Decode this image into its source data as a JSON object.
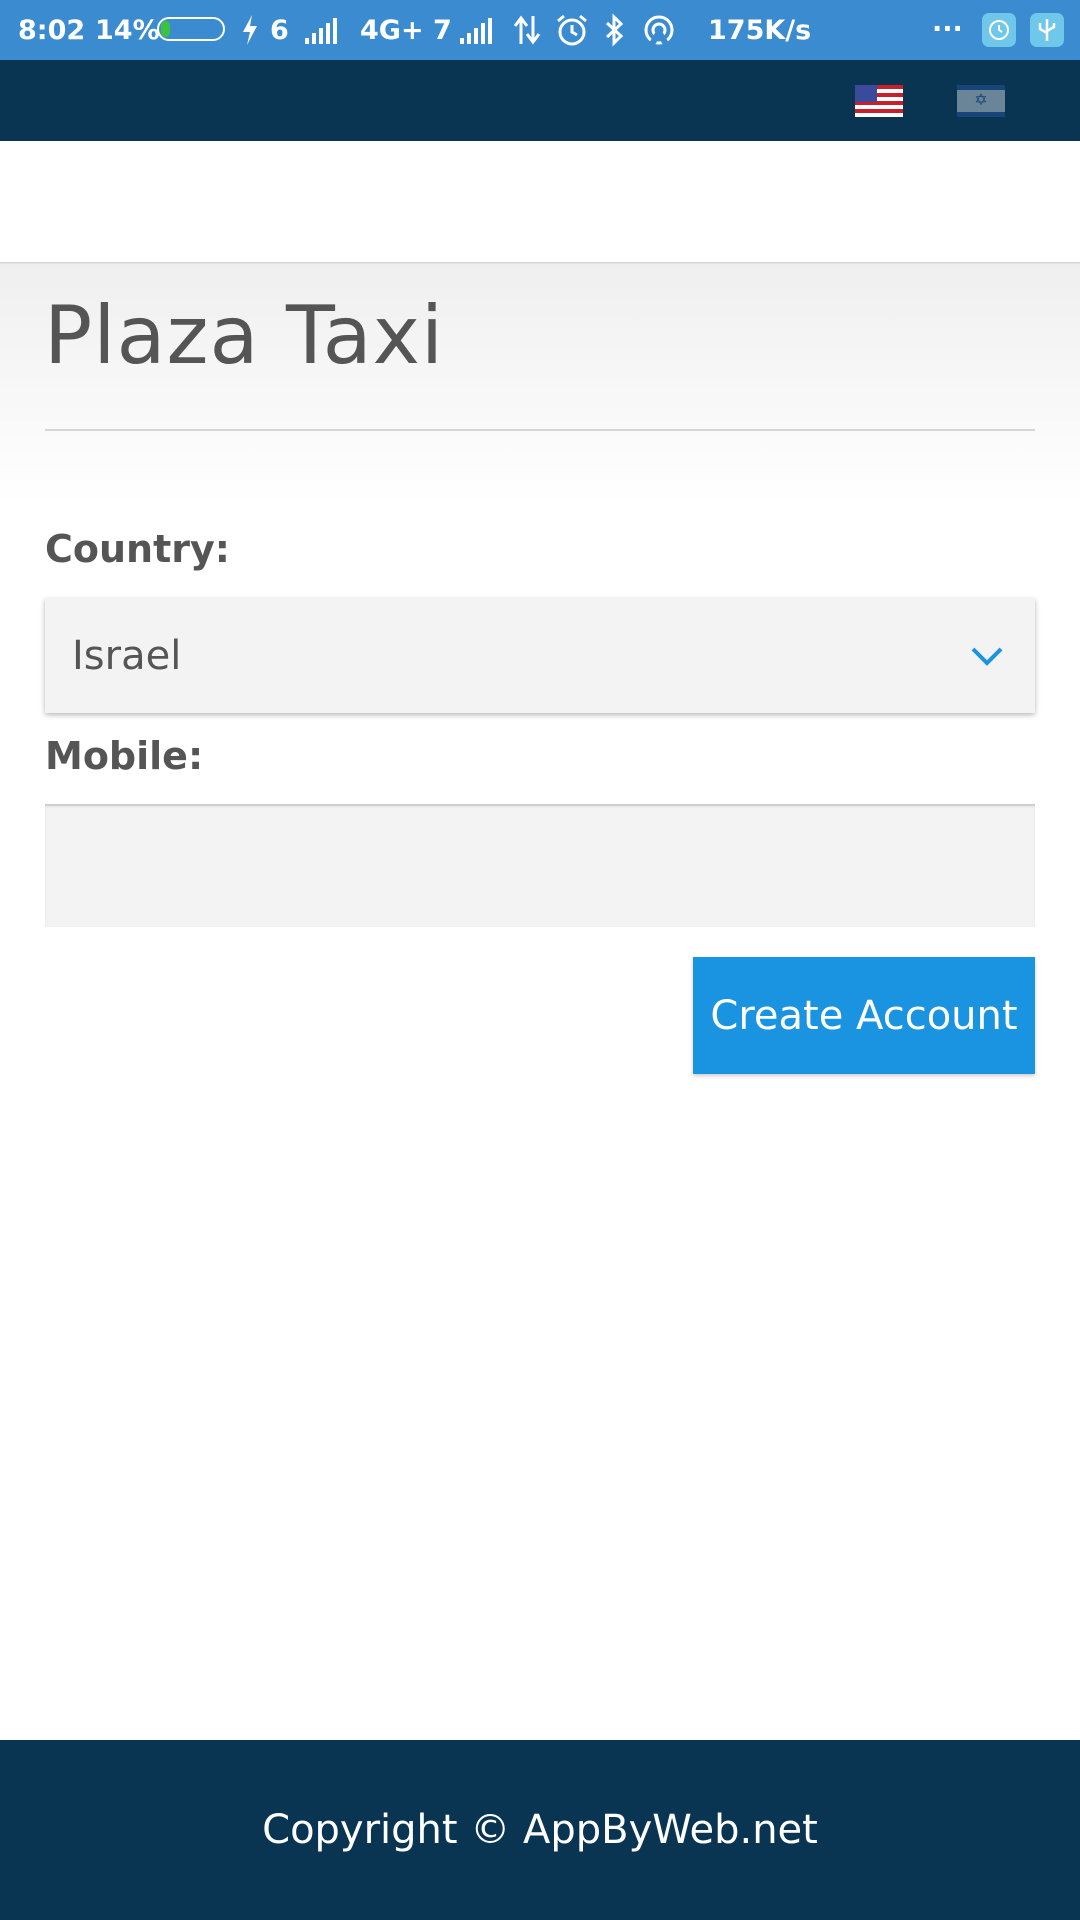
{
  "status_bar": {
    "time": "8:02",
    "battery_percent": "14%",
    "battery_level": 0.14,
    "charge_count": "6",
    "network_label": "4G+ 7",
    "speed": "175K/s",
    "more": "...",
    "icons": [
      "battery-icon",
      "lightning-icon",
      "signal-icon",
      "data-arrows-icon",
      "alarm-icon",
      "bluetooth-icon",
      "hotspot-icon",
      "clock-app-icon",
      "usb-icon"
    ],
    "color": "#3a8bd0"
  },
  "nav": {
    "flags": [
      "us-flag-icon",
      "israel-flag-icon"
    ],
    "color": "#0a3552"
  },
  "page": {
    "title": "Plaza Taxi"
  },
  "form": {
    "country_label": "Country:",
    "country_value": "Israel",
    "mobile_label": "Mobile:",
    "mobile_value": "",
    "submit_label": "Create Account",
    "accent_color": "#1a93e0"
  },
  "footer": {
    "copyright": "Copyright © AppByWeb.net"
  }
}
